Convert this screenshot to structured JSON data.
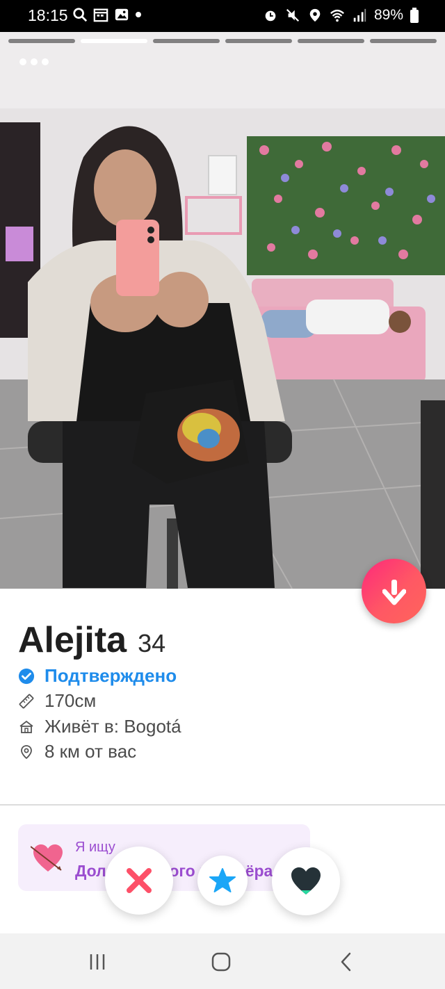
{
  "status_bar": {
    "time": "18:15",
    "battery": "89%",
    "left_icons": [
      "search-icon",
      "calendar-icon",
      "gallery-icon",
      "dot-icon"
    ],
    "right_icons": [
      "alarm-icon",
      "mute-icon",
      "location-icon",
      "wifi-icon",
      "signal-icon",
      "battery-icon"
    ]
  },
  "photo": {
    "segments": 6,
    "active_segment": 2,
    "more_icon": "more-dots-icon"
  },
  "profile": {
    "name": "Alejita",
    "age": "34",
    "verified": "Подтверждено",
    "height": "170см",
    "lives_in": "Живёт в: Bogotá",
    "distance": "8 км от вас"
  },
  "looking_for": {
    "label": "Я ищу",
    "value": "Долгосрочного партнёра"
  },
  "actions": {
    "nope_icon": "x-icon",
    "super_like_icon": "star-icon",
    "like_icon": "heart-icon"
  },
  "colors": {
    "brand_gradient_start": "#fd297b",
    "brand_gradient_end": "#ff655b",
    "verified_blue": "#1f8ceb",
    "looking_purple": "#9b4dd0",
    "nope_red": "#fd5068",
    "super_blue": "#1ba6f7",
    "like_dark": "#253238"
  }
}
